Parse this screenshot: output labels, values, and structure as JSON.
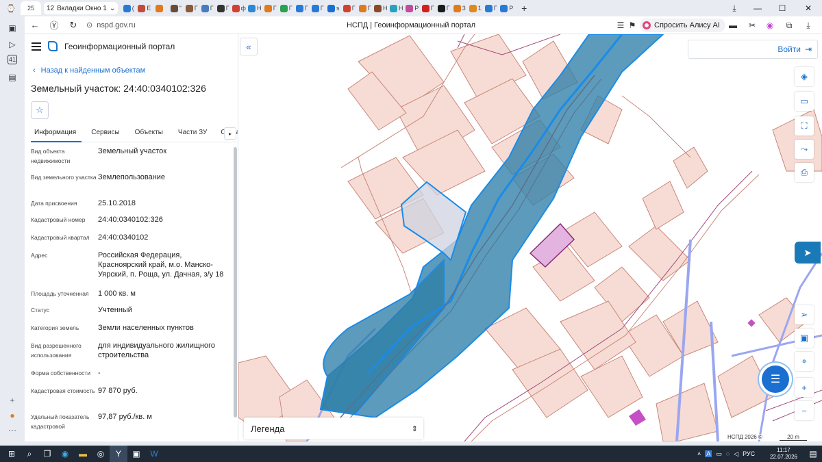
{
  "browser": {
    "tab_counter": "25",
    "group_count": "12",
    "group_label": "Вкладки Окно 1",
    "url": "nspd.gov.ru",
    "page_title": "НСПД | Геоинформационный портал",
    "alice_label": "Спросить Алису AI",
    "sidebar_badge": "41",
    "tab_favicon_colors": [
      "#2a7ad5",
      "#c24b3b",
      "#e07a1e",
      "#6a4a3a",
      "#8a5a3a",
      "#4a7ac0",
      "#333",
      "#d14030",
      "#2a8ad5",
      "#e07a1e",
      "#2aa050",
      "#2a7ad5",
      "#2a7ad5",
      "#1a6fd0",
      "#d14030",
      "#e07a1e",
      "#8a4a2a",
      "#2aa0c0",
      "#c24b9b",
      "#d02020",
      "#1a1a1a",
      "#e07a1e",
      "#e08a1e",
      "#2a7ad5",
      "#2a7ad5"
    ],
    "tab_labels": [
      "",
      "(",
      "E",
      "",
      "\"",
      "Г",
      "Г",
      "Г",
      "ф",
      "Н",
      "Г",
      "Г",
      "Г",
      "Г",
      "s",
      "Г",
      "Г",
      "Н",
      "Н",
      "Р",
      "Г",
      "Г",
      "3",
      "1",
      "Г",
      "Р"
    ]
  },
  "portal": {
    "name": "Геоинформационный портал",
    "back_link": "Назад к найденным объектам",
    "object_title": "Земельный участок: 24:40:0340102:326",
    "tabs": [
      "Информация",
      "Сервисы",
      "Объекты",
      "Части ЗУ",
      "Состав"
    ],
    "fields": [
      {
        "label": "Вид объекта недвижимости",
        "value": "Земельный участок"
      },
      {
        "label": "Вид земельного участка",
        "value": "Землепользование"
      },
      {
        "label": "Дата присвоения",
        "value": "25.10.2018"
      },
      {
        "label": "Кадастровый номер",
        "value": "24:40:0340102:326"
      },
      {
        "label": "Кадастровый квартал",
        "value": "24:40:0340102"
      },
      {
        "label": "Адрес",
        "value": "Российская Федерация, Красноярский край, м.о. Манско-Уярский, п. Роща, ул. Дачная, з/у 18"
      },
      {
        "label": "Площадь уточненная",
        "value": "1 000 кв. м"
      },
      {
        "label": "Статус",
        "value": "Учтенный"
      },
      {
        "label": "Категория земель",
        "value": "Земли населенных пунктов"
      },
      {
        "label": "Вид разрешенного использования",
        "value": "для индивидуального жилищного строительства"
      },
      {
        "label": "Форма собственности",
        "value": "-"
      },
      {
        "label": "Кадастровая стоимость",
        "value": "97 870 руб."
      },
      {
        "label": "Удельный показатель кадастровой",
        "value": "97,87 руб./кв. м"
      }
    ]
  },
  "map": {
    "login_label": "Войти",
    "legend_label": "Легенда",
    "copyright": "НСПД 2026 ©",
    "scale": "20 m",
    "colors": {
      "river": "#2e7fa8",
      "river_edge": "#1a8be8",
      "parcel": "#f6dcd4",
      "parcel_edge": "#c9877a",
      "selected": "#cfd3e0",
      "purple": "#e3b4e0"
    }
  },
  "taskbar": {
    "time": "11:17",
    "date": "22.07.2026",
    "lang": "РУС"
  }
}
